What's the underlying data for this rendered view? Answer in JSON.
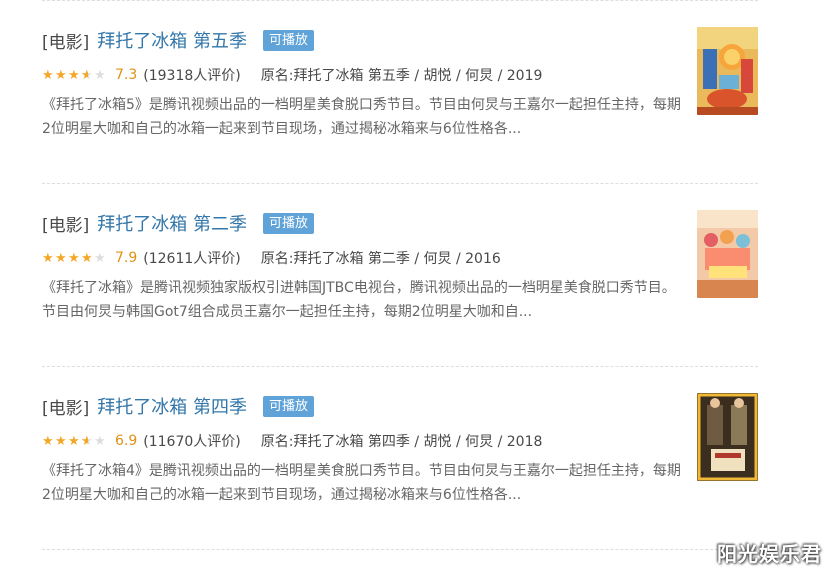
{
  "results": [
    {
      "category": "[电影]",
      "title": "拜托了冰箱 第五季",
      "badge": "可播放",
      "stars": [
        1,
        1,
        1,
        0.5,
        0
      ],
      "score": "7.3",
      "votes": "(19318人评价)",
      "original": "原名:拜托了冰箱 第五季 / 胡悦 / 何炅 / 2019",
      "description": "《拜托了冰箱5》是腾讯视频出品的一档明星美食脱口秀节目。节目由何炅与王嘉尔一起担任主持，每期2位明星大咖和自己的冰箱一起来到节目现场，通过揭秘冰箱来与6位性格各..."
    },
    {
      "category": "[电影]",
      "title": "拜托了冰箱 第二季",
      "badge": "可播放",
      "stars": [
        1,
        1,
        1,
        1,
        0
      ],
      "score": "7.9",
      "votes": "(12611人评价)",
      "original": "原名:拜托了冰箱 第二季 / 何炅 / 2016",
      "description": "《拜托了冰箱》是腾讯视频独家版权引进韩国JTBC电视台，腾讯视频出品的一档明星美食脱口秀节目。节目由何炅与韩国Got7组合成员王嘉尔一起担任主持，每期2位明星大咖和自..."
    },
    {
      "category": "[电影]",
      "title": "拜托了冰箱 第四季",
      "badge": "可播放",
      "stars": [
        1,
        1,
        1,
        0.5,
        0
      ],
      "score": "6.9",
      "votes": "(11670人评价)",
      "original": "原名:拜托了冰箱 第四季 / 胡悦 / 何炅 / 2018",
      "description": "《拜托了冰箱4》是腾讯视频出品的一档明星美食脱口秀节目。节目由何炅与王嘉尔一起担任主持，每期2位明星大咖和自己的冰箱一起来到节目现场，通过揭秘冰箱来与6位性格各..."
    }
  ],
  "watermark": "阳光娱乐君",
  "colors": {
    "title": "#3377aa",
    "badge": "#5fa3d9",
    "star": "#f5a623",
    "score": "#e09015"
  }
}
